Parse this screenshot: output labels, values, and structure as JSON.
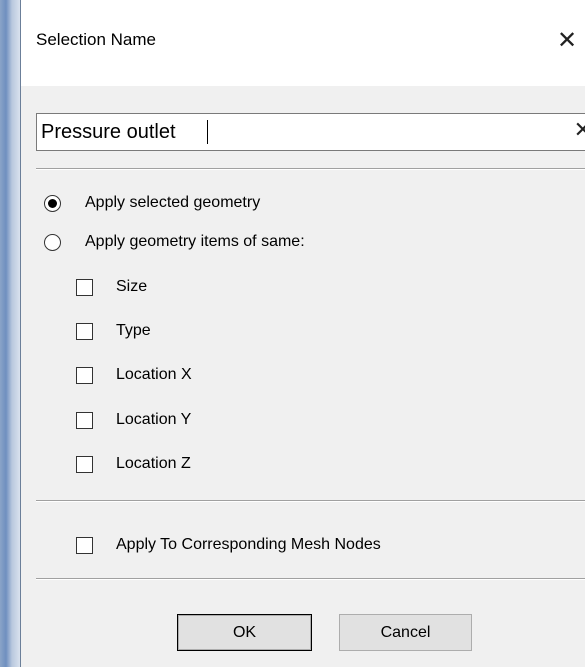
{
  "dialog": {
    "title": "Selection Name",
    "close_glyph": "✕"
  },
  "name_field": {
    "value": "Pressure outlet",
    "clear_glyph": "✕"
  },
  "apply_options": {
    "selected": "apply_selected",
    "radios": [
      {
        "id": "apply_selected",
        "label": "Apply selected geometry",
        "checked": true
      },
      {
        "id": "apply_same",
        "label": "Apply geometry items of same:",
        "checked": false
      }
    ],
    "checkboxes": [
      {
        "label": "Size",
        "checked": false
      },
      {
        "label": "Type",
        "checked": false
      },
      {
        "label": "Location X",
        "checked": false
      },
      {
        "label": "Location Y",
        "checked": false
      },
      {
        "label": "Location Z",
        "checked": false
      }
    ]
  },
  "mesh_nodes": {
    "label": "Apply To Corresponding Mesh Nodes",
    "checked": false
  },
  "buttons": {
    "ok": "OK",
    "cancel": "Cancel"
  }
}
